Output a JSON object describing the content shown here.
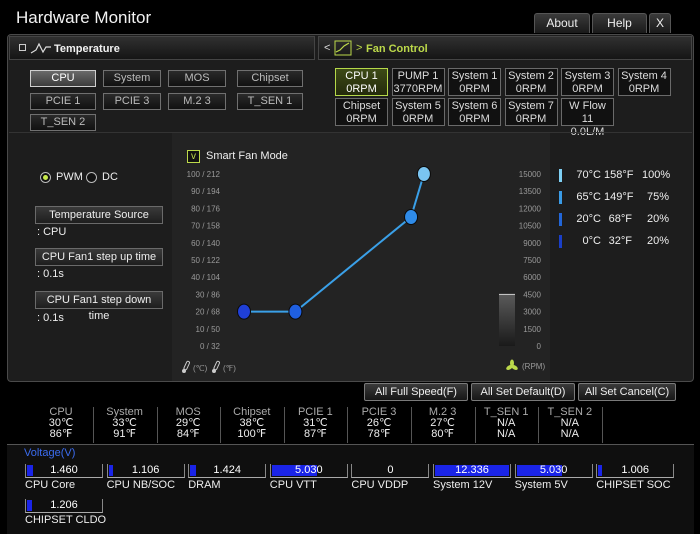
{
  "window": {
    "title": "Hardware Monitor",
    "buttons": {
      "about": "About",
      "help": "Help",
      "close": "X"
    }
  },
  "temperature_panel": {
    "title": "Temperature",
    "sources": [
      {
        "label": "CPU",
        "active": true
      },
      {
        "label": "System",
        "active": false
      },
      {
        "label": "MOS",
        "active": false
      },
      {
        "label": "Chipset",
        "active": false
      },
      {
        "label": "PCIE 1",
        "active": false
      },
      {
        "label": "PCIE 3",
        "active": false
      },
      {
        "label": "M.2 3",
        "active": false
      },
      {
        "label": "T_SEN 1",
        "active": false
      },
      {
        "label": "T_SEN 2",
        "active": false
      }
    ]
  },
  "fan_panel": {
    "title": "Fan Control",
    "nav": "<",
    "fans": [
      {
        "name": "CPU 1",
        "value": "0RPM",
        "active": true
      },
      {
        "name": "PUMP 1",
        "value": "3770RPM",
        "active": false
      },
      {
        "name": "System 1",
        "value": "0RPM",
        "active": false
      },
      {
        "name": "System 2",
        "value": "0RPM",
        "active": false
      },
      {
        "name": "System 3",
        "value": "0RPM",
        "active": false
      },
      {
        "name": "System 4",
        "value": "0RPM",
        "active": false
      },
      {
        "name": "Chipset",
        "value": "0RPM",
        "active": false
      },
      {
        "name": "System 5",
        "value": "0RPM",
        "active": false
      },
      {
        "name": "System 6",
        "value": "0RPM",
        "active": false
      },
      {
        "name": "System 7",
        "value": "0RPM",
        "active": false
      },
      {
        "name": "W Flow 11",
        "value": "0.0L/M",
        "active": false
      }
    ]
  },
  "fan_config": {
    "mode_pwm": "PWM",
    "mode_dc": "DC",
    "pwm_selected": true,
    "temp_source_label": "Temperature Source",
    "temp_source_value": ": CPU",
    "step_up_label": "CPU Fan1 step up time",
    "step_up_value": ": 0.1s",
    "step_down_label": "CPU Fan1 step down time",
    "step_down_value": ": 0.1s",
    "smart_fan_checkbox": "v",
    "smart_fan_label": "Smart Fan Mode"
  },
  "chart_data": {
    "type": "line",
    "title": "",
    "left_ticks": [
      "100 / 212",
      "90 / 194",
      "80 / 176",
      "70 / 158",
      "60 / 140",
      "50 / 122",
      "40 / 104",
      "30 /  86",
      "20 /  68",
      "10 /  50",
      "0 /  32"
    ],
    "right_ticks": [
      "15000",
      "13500",
      "12000",
      "10500",
      "9000",
      "7500",
      "6000",
      "4500",
      "3000",
      "1500",
      "0"
    ],
    "xlabel_c": "(℃)",
    "xlabel_f": "(℉)",
    "ylabel_right": "(RPM)",
    "temp_range": [
      0,
      100
    ],
    "duty_range": [
      0,
      100
    ],
    "points": [
      {
        "temp_c": 0,
        "duty": 20
      },
      {
        "temp_c": 20,
        "duty": 20
      },
      {
        "temp_c": 65,
        "duty": 75
      },
      {
        "temp_c": 70,
        "duty": 100
      }
    ],
    "point_colors": [
      "#1f3fd6",
      "#1f5fe0",
      "#2f8be8",
      "#7ac4f0"
    ],
    "line_color": "#3aa0e8",
    "current_rpm_level": 0.3
  },
  "legend": [
    {
      "c": "70°C",
      "f": "158°F",
      "pct": "100%",
      "color": "#7fd0f4"
    },
    {
      "c": "65°C",
      "f": "149°F",
      "pct": "75%",
      "color": "#3a9be6"
    },
    {
      "c": "20°C",
      "f": "68°F",
      "pct": "20%",
      "color": "#2266d8"
    },
    {
      "c": "0°C",
      "f": "32°F",
      "pct": "20%",
      "color": "#1a3fc8"
    }
  ],
  "actions": {
    "full_speed": "All Full Speed(F)",
    "set_default": "All Set Default(D)",
    "set_cancel": "All Set Cancel(C)"
  },
  "temps": [
    {
      "name": "CPU",
      "c": "30℃",
      "f": "86℉"
    },
    {
      "name": "System",
      "c": "33℃",
      "f": "91℉"
    },
    {
      "name": "MOS",
      "c": "29℃",
      "f": "84℉"
    },
    {
      "name": "Chipset",
      "c": "38℃",
      "f": "100℉"
    },
    {
      "name": "PCIE 1",
      "c": "31℃",
      "f": "87℉"
    },
    {
      "name": "PCIE 3",
      "c": "26℃",
      "f": "78℉"
    },
    {
      "name": "M.2 3",
      "c": "27℃",
      "f": "80℉"
    },
    {
      "name": "T_SEN 1",
      "c": "N/A",
      "f": "N/A"
    },
    {
      "name": "T_SEN 2",
      "c": "N/A",
      "f": "N/A"
    }
  ],
  "voltage": {
    "title": "Voltage(V)",
    "items": [
      {
        "name": "CPU Core",
        "value": "1.460",
        "fill": 0.08
      },
      {
        "name": "CPU NB/SOC",
        "value": "1.106",
        "fill": 0.06
      },
      {
        "name": "DRAM",
        "value": "1.424",
        "fill": 0.08
      },
      {
        "name": "CPU VTT",
        "value": "5.030",
        "fill": 0.6
      },
      {
        "name": "CPU VDDP",
        "value": "0",
        "fill": 0
      },
      {
        "name": "System 12V",
        "value": "12.336",
        "fill": 0.98
      },
      {
        "name": "System 5V",
        "value": "5.030",
        "fill": 0.6
      },
      {
        "name": "CHIPSET SOC",
        "value": "1.006",
        "fill": 0.05
      },
      {
        "name": "CHIPSET CLDO",
        "value": "1.206",
        "fill": 0.07
      }
    ]
  }
}
